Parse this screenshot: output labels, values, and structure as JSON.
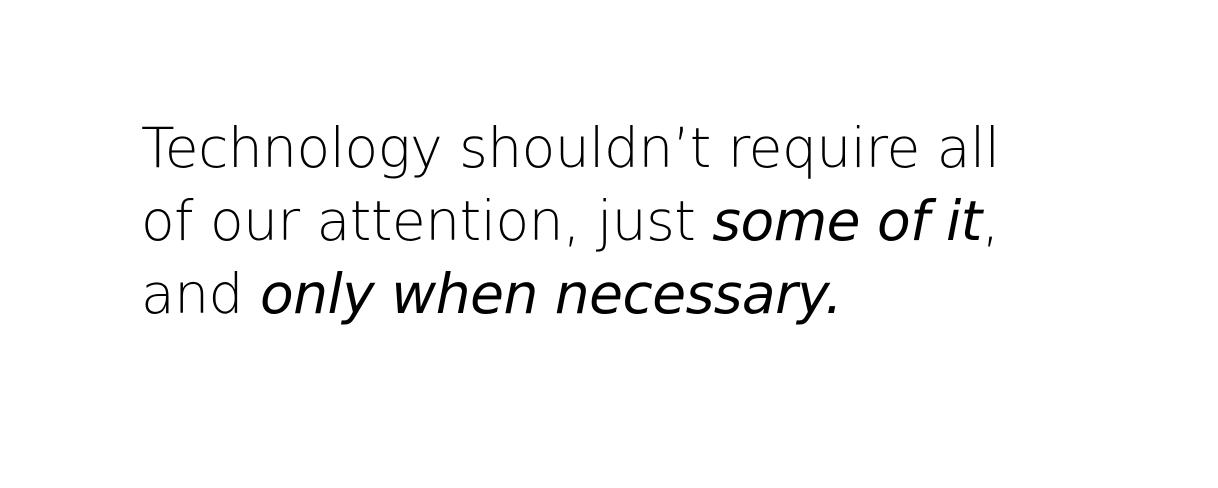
{
  "quote": {
    "line1": "Technology shouldn’t require all",
    "line2_a": "of our attention, just ",
    "line2_em": "some of it",
    "line2_b": ",",
    "line3_a": "and ",
    "line3_em": "only when necessary."
  },
  "colors": {
    "text": "#000000",
    "background": "#ffffff"
  }
}
